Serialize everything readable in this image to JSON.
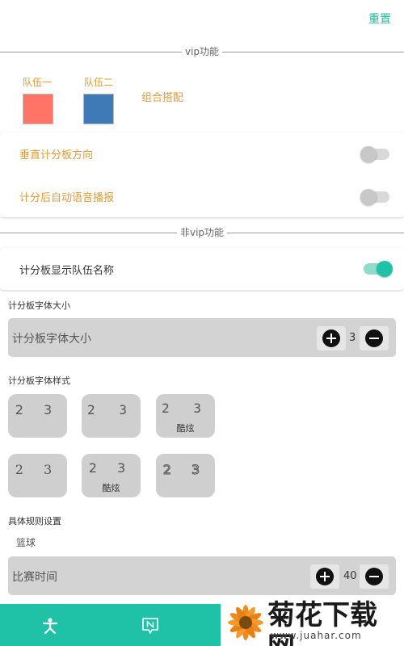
{
  "header": {
    "reset_label": "重置"
  },
  "vip": {
    "divider_label": "vip功能",
    "team1": {
      "label": "队伍一",
      "color": "#ff7467"
    },
    "team2": {
      "label": "队伍二",
      "color": "#3e7ab5"
    },
    "combo_label": "组合搭配",
    "vertical_label": "垂直计分板方向",
    "vertical_on": false,
    "voice_label": "计分后自动语音播报",
    "voice_on": false
  },
  "nonvip": {
    "divider_label": "非vip功能",
    "show_names_label": "计分板显示队伍名称",
    "show_names_on": true
  },
  "font_size": {
    "section_title": "计分板字体大小",
    "control_label": "计分板字体大小",
    "value": "3"
  },
  "font_style": {
    "section_title": "计分板字体样式",
    "options": [
      {
        "digits": "2 3",
        "caption": "",
        "selected": true
      },
      {
        "digits": "2 3",
        "caption": "",
        "selected": false
      },
      {
        "digits": "2 3",
        "caption": "酷炫",
        "selected": false
      },
      {
        "digits": "2 3",
        "caption": "",
        "selected": false
      },
      {
        "digits": "2 3",
        "caption": "酷炫",
        "selected": false
      },
      {
        "digits": "2 3",
        "caption": "",
        "selected": false
      }
    ]
  },
  "rules": {
    "section_title": "具体规则设置",
    "sport": "篮球",
    "time_label": "比赛时间",
    "time_value": "40"
  },
  "bottom_nav": {
    "items": [
      {
        "icon": "person-icon"
      },
      {
        "icon": "notice-icon"
      }
    ]
  },
  "watermark": {
    "title": "菊花下载网",
    "url": "www.juahar.com"
  },
  "colors": {
    "accent": "#1fc2a7",
    "label_orange": "#e09a35",
    "selected_style": "#ffa500"
  }
}
